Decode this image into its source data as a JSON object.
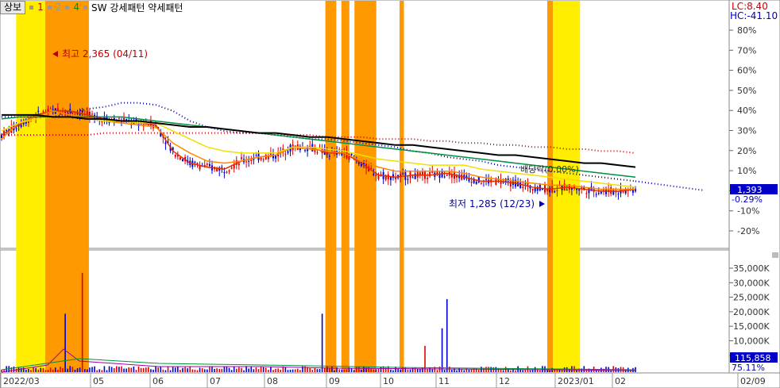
{
  "toolbar": {
    "tab_label": "상보",
    "ma_buttons": [
      {
        "label": "1",
        "color": "#d00000"
      },
      {
        "label": "2",
        "color": "#999999"
      },
      {
        "label": "4",
        "color": "#009000"
      }
    ],
    "indicator_title": "SW 강세패턴  약세패턴"
  },
  "price_info": {
    "lc": "LC:8.40",
    "hc": "HC:-41.10",
    "current_price": "1,393",
    "current_change": "-0.29%"
  },
  "annotations": {
    "high_label": "최고 2,365 (04/11)",
    "low_label": "최저 1,285 (12/23)",
    "alignment_label": "배당락(0.00%)"
  },
  "volume_info": {
    "current_volume": "115,858",
    "volume_ratio": "75.11%"
  },
  "colors": {
    "up": "#e00000",
    "down": "#0000d0",
    "orange_band": "#ff9900",
    "yellow_band": "#ffee00",
    "ma5": "#e03000",
    "ma20": "#ff8800",
    "ma60": "#f0e000",
    "ma120": "#009040",
    "ma240": "#000000",
    "dotted_red": "#d00000",
    "dotted_blue": "#0000a0"
  },
  "chart_data": {
    "type": "candlestick",
    "price_axis": {
      "ticks": [
        "80%",
        "70%",
        "60%",
        "50%",
        "40%",
        "30%",
        "20%",
        "10%",
        "0%",
        "-10%",
        "-20%"
      ],
      "range": [
        -25,
        85
      ]
    },
    "volume_axis": {
      "ticks": [
        "35,000K",
        "30,000K",
        "25,000K",
        "20,000K",
        "15,000K",
        "10,000K",
        "5,000K"
      ],
      "range": [
        0,
        40000
      ]
    },
    "x_axis": {
      "labels": [
        "2022/03",
        "05",
        "06",
        "07",
        "08",
        "09",
        "10",
        "11",
        "12",
        "2023/01",
        "02",
        "02/09"
      ]
    },
    "bands": [
      {
        "color": "yellow",
        "start": 0.02,
        "end": 0.06
      },
      {
        "color": "orange",
        "start": 0.06,
        "end": 0.12
      },
      {
        "color": "orange",
        "start": 0.445,
        "end": 0.46
      },
      {
        "color": "orange",
        "start": 0.467,
        "end": 0.478
      },
      {
        "color": "orange",
        "start": 0.485,
        "end": 0.515
      },
      {
        "color": "orange",
        "start": 0.547,
        "end": 0.553
      },
      {
        "color": "orange",
        "start": 0.75,
        "end": 0.758
      },
      {
        "color": "yellow",
        "start": 0.758,
        "end": 0.795
      }
    ],
    "price_series": [
      {
        "name": "ma5",
        "values": [
          28,
          33,
          38,
          40,
          40,
          38,
          36,
          35,
          34,
          33,
          20,
          14,
          12,
          11,
          15,
          17,
          18,
          22,
          22,
          19,
          19,
          14,
          8,
          7,
          8,
          8,
          9,
          7,
          5,
          5,
          4,
          2,
          1,
          2,
          1,
          0,
          0,
          1
        ]
      },
      {
        "name": "ma20",
        "values": [
          26,
          34,
          37,
          40,
          38,
          37,
          35,
          34,
          33,
          32,
          24,
          19,
          15,
          14,
          15,
          17,
          18,
          22,
          21,
          20,
          19,
          15,
          12,
          10,
          10,
          10,
          10,
          9,
          7,
          6,
          5,
          4,
          3,
          3,
          2,
          1,
          1,
          1
        ]
      },
      {
        "name": "ma60",
        "values": [
          30,
          34,
          36,
          37,
          37,
          36,
          35,
          35,
          34,
          34,
          30,
          26,
          22,
          20,
          19,
          19,
          19,
          22,
          22,
          21,
          20,
          18,
          16,
          15,
          14,
          13,
          13,
          13,
          11,
          10,
          9,
          8,
          7,
          6,
          5,
          4,
          3,
          2
        ]
      },
      {
        "name": "ma120",
        "values": [
          36,
          37,
          37,
          37,
          37,
          37,
          37,
          37,
          36,
          35,
          34,
          33,
          32,
          31,
          30,
          29,
          28,
          27,
          26,
          25,
          24,
          23,
          22,
          21,
          20,
          19,
          18,
          17,
          16,
          15,
          14,
          13,
          12,
          11,
          10,
          9,
          8,
          7
        ]
      },
      {
        "name": "ma240",
        "values": [
          38,
          38,
          38,
          37,
          37,
          36,
          36,
          35,
          35,
          34,
          33,
          32,
          32,
          31,
          30,
          29,
          29,
          28,
          27,
          27,
          26,
          25,
          24,
          23,
          23,
          22,
          21,
          20,
          19,
          18,
          18,
          17,
          16,
          15,
          14,
          14,
          13,
          12
        ]
      }
    ],
    "dotted_series": [
      {
        "name": "envelope-upper",
        "values": [
          28,
          28,
          28,
          28,
          28,
          28,
          29,
          29,
          29,
          29,
          29,
          29,
          29,
          29,
          29,
          29,
          28,
          28,
          28,
          27,
          27,
          27,
          26,
          26,
          26,
          25,
          25,
          24,
          24,
          23,
          23,
          22,
          22,
          21,
          21,
          20,
          20,
          19
        ]
      },
      {
        "name": "envelope-lower",
        "values": [
          37,
          37,
          37,
          37,
          39,
          41,
          42,
          44,
          44,
          43,
          40,
          35,
          32,
          30,
          29,
          29,
          28,
          27,
          26,
          26,
          25,
          24,
          23,
          22,
          20,
          19,
          17,
          16,
          15,
          13,
          12,
          11,
          10,
          9,
          8,
          7,
          6,
          5
        ]
      }
    ]
  }
}
